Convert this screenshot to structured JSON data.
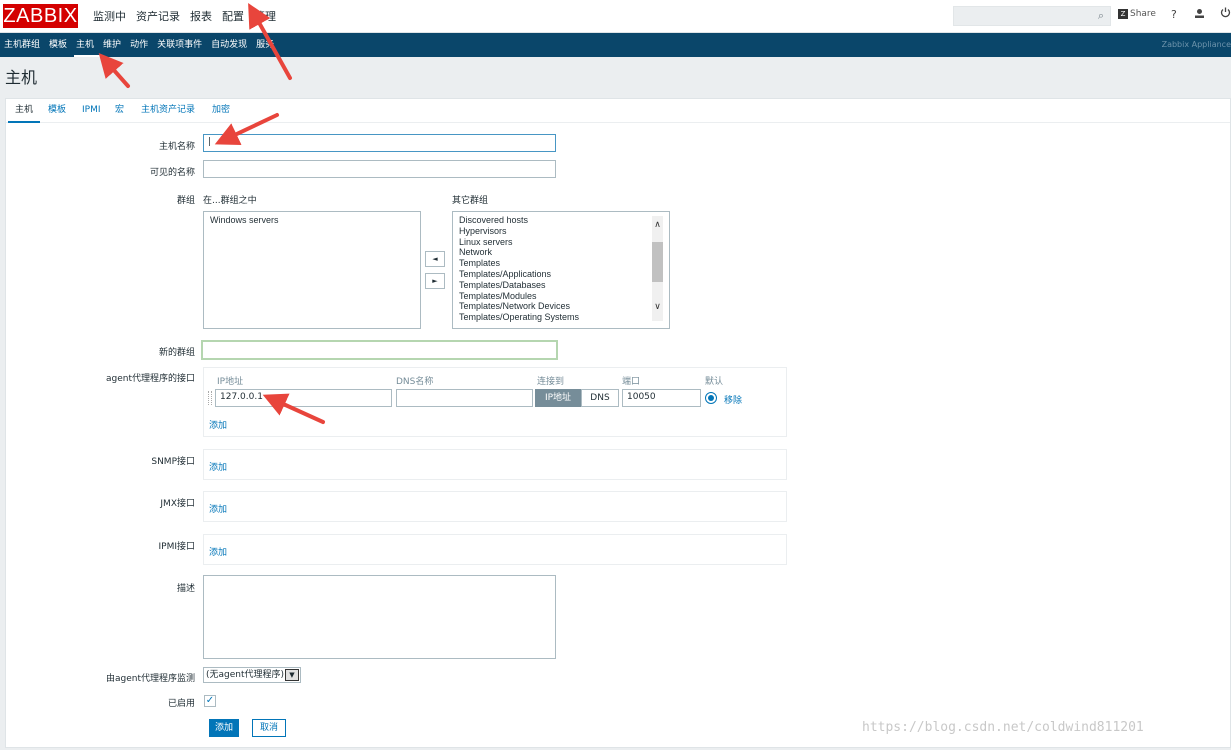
{
  "header": {
    "logo": "ZABBIX",
    "nav": [
      "监测中",
      "资产记录",
      "报表",
      "配置",
      "管理"
    ],
    "share": "Share",
    "help": "?"
  },
  "subnav": {
    "items": [
      "主机群组",
      "模板",
      "主机",
      "维护",
      "动作",
      "关联项事件",
      "自动发现",
      "服务"
    ],
    "appliance": "Zabbix Appliance"
  },
  "page": {
    "title": "主机"
  },
  "tabs": [
    "主机",
    "模板",
    "IPMI",
    "宏",
    "主机资产记录",
    "加密"
  ],
  "form": {
    "host_name_label": "主机名称",
    "host_name_value": "|",
    "visible_name_label": "可见的名称",
    "visible_name_value": "",
    "groups_label": "群组",
    "in_groups_label": "在...群组之中",
    "in_groups": [
      "Windows servers"
    ],
    "other_groups_label": "其它群组",
    "other_groups": [
      "Discovered hosts",
      "Hypervisors",
      "Linux servers",
      "Network",
      "Templates",
      "Templates/Applications",
      "Templates/Databases",
      "Templates/Modules",
      "Templates/Network Devices",
      "Templates/Operating Systems"
    ],
    "move_left": "◄",
    "move_right": "►",
    "new_group_label": "新的群组",
    "new_group_value": "",
    "agent_iface_label": "agent代理程序的接口",
    "iface_headers": {
      "ip": "IP地址",
      "dns": "DNS名称",
      "connect": "连接到",
      "port": "端口",
      "default": "默认"
    },
    "iface": {
      "ip": "127.0.0.1",
      "dns": "",
      "connect_ip": "IP地址",
      "connect_dns": "DNS",
      "port": "10050",
      "remove": "移除"
    },
    "add_link": "添加",
    "snmp_label": "SNMP接口",
    "jmx_label": "JMX接口",
    "ipmi_label": "IPMI接口",
    "description_label": "描述",
    "description_value": "",
    "proxy_label": "由agent代理程序监测",
    "proxy_value": "(无agent代理程序)",
    "enabled_label": "已启用",
    "enabled_check": "✓",
    "add_button": "添加",
    "cancel_button": "取消"
  },
  "watermark": "https://blog.csdn.net/coldwind811201",
  "colors": {
    "logo": "#d40000",
    "subnav": "#0a466a",
    "link": "#0275b8",
    "annotation_arrow": "#e8453c"
  }
}
